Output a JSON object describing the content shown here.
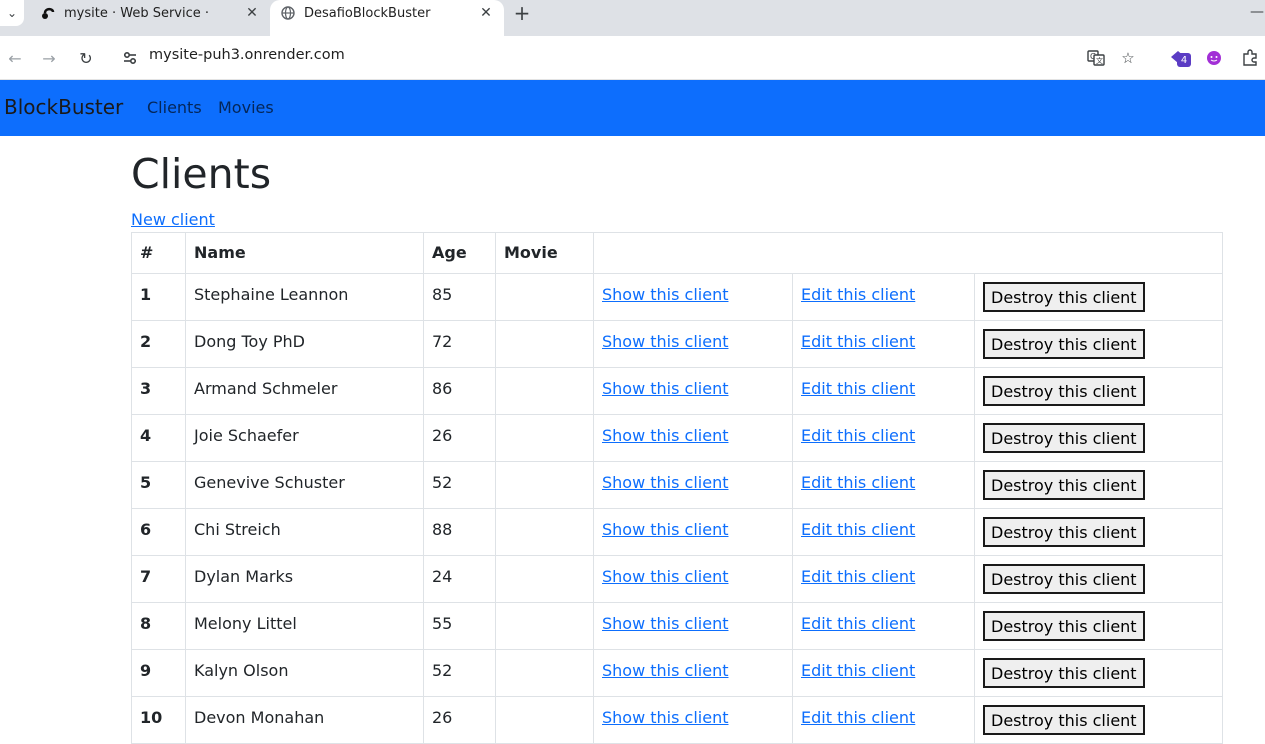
{
  "browser": {
    "tabs": [
      {
        "title": "mysite · Web Service ·",
        "icon": "render-logo-icon",
        "active": false
      },
      {
        "title": "DesafioBlockBuster",
        "icon": "globe-icon",
        "active": true
      }
    ],
    "url": "mysite-puh3.onrender.com",
    "extension_badge": "4"
  },
  "navbar": {
    "brand": "BlockBuster",
    "links": [
      "Clients",
      "Movies"
    ],
    "color": "#0d6efd"
  },
  "page": {
    "title": "Clients",
    "new_link": "New client",
    "headers": [
      "#",
      "Name",
      "Age",
      "Movie",
      ""
    ],
    "actions": {
      "show": "Show this client",
      "edit": "Edit this client",
      "destroy": "Destroy this client"
    },
    "rows": [
      {
        "id": "1",
        "name": "Stephaine Leannon",
        "age": "85",
        "movie": ""
      },
      {
        "id": "2",
        "name": "Dong Toy PhD",
        "age": "72",
        "movie": ""
      },
      {
        "id": "3",
        "name": "Armand Schmeler",
        "age": "86",
        "movie": ""
      },
      {
        "id": "4",
        "name": "Joie Schaefer",
        "age": "26",
        "movie": ""
      },
      {
        "id": "5",
        "name": "Genevive Schuster",
        "age": "52",
        "movie": ""
      },
      {
        "id": "6",
        "name": "Chi Streich",
        "age": "88",
        "movie": ""
      },
      {
        "id": "7",
        "name": "Dylan Marks",
        "age": "24",
        "movie": ""
      },
      {
        "id": "8",
        "name": "Melony Littel",
        "age": "55",
        "movie": ""
      },
      {
        "id": "9",
        "name": "Kalyn Olson",
        "age": "52",
        "movie": ""
      },
      {
        "id": "10",
        "name": "Devon Monahan",
        "age": "26",
        "movie": ""
      }
    ]
  }
}
